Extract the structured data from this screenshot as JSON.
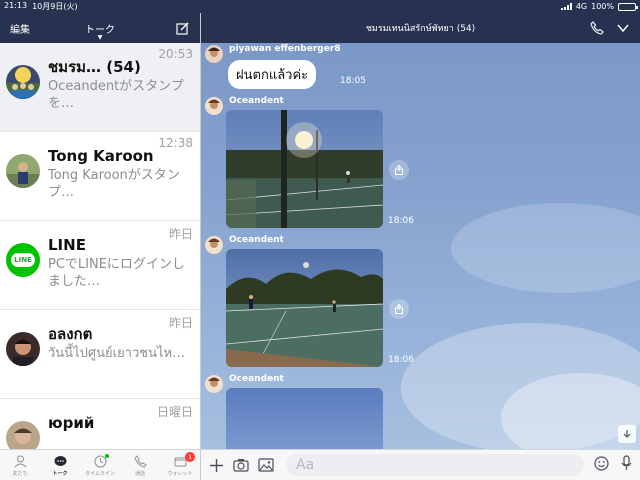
{
  "status_bar": {
    "time": "21:13",
    "date": "10月9日(火)",
    "network": "4G",
    "battery_text": "100%",
    "battery_level": 1.0
  },
  "left_header": {
    "edit_label": "編集",
    "title": "トーク",
    "compose_icon": "compose-icon"
  },
  "chats": [
    {
      "name": "ชมรม… (54)",
      "preview": "Oceandentがスタンプを…",
      "time": "20:53",
      "avatar": "group-photo"
    },
    {
      "name": "Tong Karoon",
      "preview": "Tong Karoonがスタンプ…",
      "time": "12:38",
      "avatar": "user-photo"
    },
    {
      "name": "LINE",
      "preview": "PCでLINEにログインしました…",
      "time": "昨日",
      "avatar": "line-logo",
      "logo_text": "LINE"
    },
    {
      "name": "อลงกต",
      "preview": "วันนี้ไปศูนย์เยาวชนไห…",
      "time": "昨日",
      "avatar": "user-photo"
    },
    {
      "name": "юрий",
      "preview": "",
      "time": "日曜日",
      "avatar": "user-photo"
    }
  ],
  "tab_bar": {
    "tabs": [
      {
        "label": "友だち",
        "icon": "person-icon"
      },
      {
        "label": "トーク",
        "icon": "chat-icon",
        "active": true
      },
      {
        "label": "タイムライン",
        "icon": "clock-icon",
        "dot": true
      },
      {
        "label": "通話",
        "icon": "phone-icon"
      },
      {
        "label": "ウォレット",
        "icon": "wallet-icon",
        "badge": "1"
      }
    ]
  },
  "chat_header": {
    "title": "ชมรมเทนนิสรักษ์พัทยา (54)",
    "call_icon": "phone-icon",
    "menu_icon": "chevron-down-icon"
  },
  "messages": [
    {
      "sender": "piyawan effenberger8",
      "type": "text",
      "text": "ฝนตกแล้วค่ะ",
      "time": "18:05"
    },
    {
      "sender": "Oceandent",
      "type": "photo",
      "time": "18:06"
    },
    {
      "sender": "Oceandent",
      "type": "photo",
      "time": "18:06"
    },
    {
      "sender": "Oceandent",
      "type": "photo",
      "time": ""
    }
  ],
  "input_bar": {
    "placeholder": "Aa",
    "icons": [
      "plus-icon",
      "camera-icon",
      "image-icon",
      "emoji-icon",
      "microphone-icon"
    ]
  },
  "colors": {
    "header_bg": "#263250",
    "chat_bg": "#85a2ce",
    "line_green": "#00c300",
    "badge_red": "#ff3b30"
  }
}
